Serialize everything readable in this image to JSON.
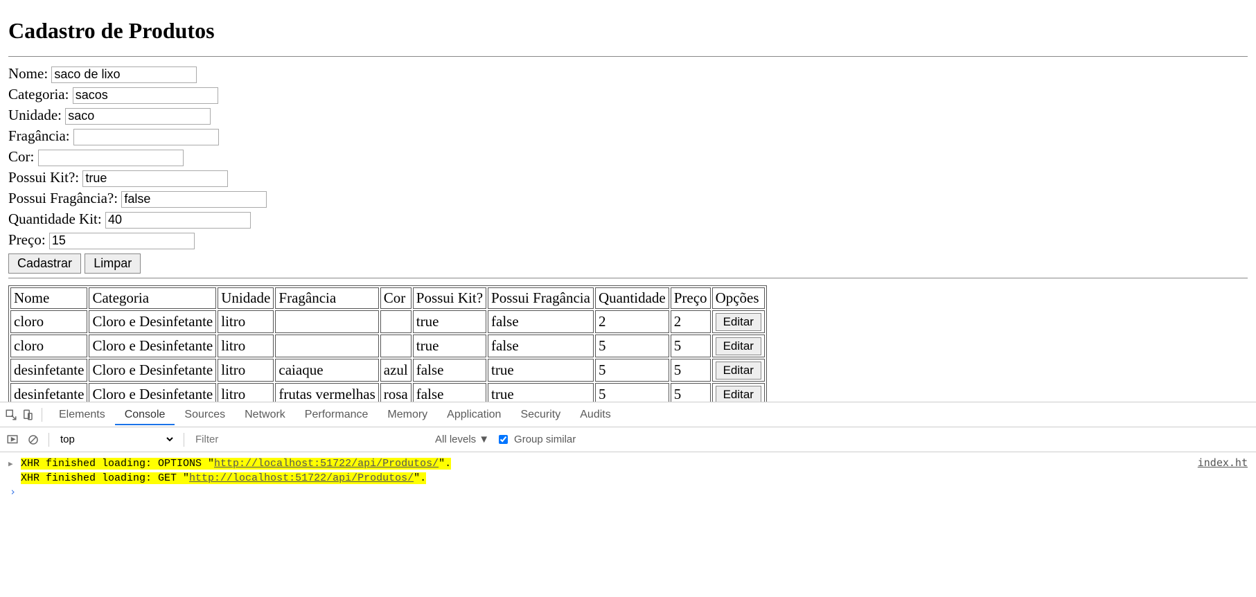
{
  "page": {
    "title": "Cadastro de Produtos"
  },
  "form": {
    "nome": {
      "label": "Nome:",
      "value": "saco de lixo"
    },
    "categoria": {
      "label": "Categoria:",
      "value": "sacos"
    },
    "unidade": {
      "label": "Unidade:",
      "value": "saco"
    },
    "fragancia": {
      "label": "Fragância:",
      "value": ""
    },
    "cor": {
      "label": "Cor:",
      "value": ""
    },
    "possuiKit": {
      "label": "Possui Kit?:",
      "value": "true"
    },
    "possuiFragancia": {
      "label": "Possui Fragância?:",
      "value": "false"
    },
    "quantidadeKit": {
      "label": "Quantidade Kit:",
      "value": "40"
    },
    "preco": {
      "label": "Preço:",
      "value": "15"
    },
    "buttons": {
      "cadastrar": "Cadastrar",
      "limpar": "Limpar"
    }
  },
  "table": {
    "headers": [
      "Nome",
      "Categoria",
      "Unidade",
      "Fragância",
      "Cor",
      "Possui Kit?",
      "Possui Fragância",
      "Quantidade",
      "Preço",
      "Opções"
    ],
    "editLabel": "Editar",
    "rows": [
      {
        "nome": "cloro",
        "categoria": "Cloro e Desinfetante",
        "unidade": "litro",
        "fragancia": "",
        "cor": "",
        "possuiKit": "true",
        "possuiFragancia": "false",
        "quantidade": "2",
        "preco": "2"
      },
      {
        "nome": "cloro",
        "categoria": "Cloro e Desinfetante",
        "unidade": "litro",
        "fragancia": "",
        "cor": "",
        "possuiKit": "true",
        "possuiFragancia": "false",
        "quantidade": "5",
        "preco": "5"
      },
      {
        "nome": "desinfetante",
        "categoria": "Cloro e Desinfetante",
        "unidade": "litro",
        "fragancia": "caiaque",
        "cor": "azul",
        "possuiKit": "false",
        "possuiFragancia": "true",
        "quantidade": "5",
        "preco": "5"
      },
      {
        "nome": "desinfetante",
        "categoria": "Cloro e Desinfetante",
        "unidade": "litro",
        "fragancia": "frutas vermelhas",
        "cor": "rosa",
        "possuiKit": "false",
        "possuiFragancia": "true",
        "quantidade": "5",
        "preco": "5"
      }
    ]
  },
  "devtools": {
    "tabs": [
      "Elements",
      "Console",
      "Sources",
      "Network",
      "Performance",
      "Memory",
      "Application",
      "Security",
      "Audits"
    ],
    "activeTab": "Console",
    "toolbar": {
      "context": "top",
      "filterPlaceholder": "Filter",
      "levels": "All levels",
      "groupSimilar": "Group similar"
    },
    "sourceLink": "index.ht",
    "log": [
      {
        "prefix": "XHR finished loading: ",
        "method": "OPTIONS",
        "q1": " \"",
        "url": "http://localhost:51722/api/Produtos/",
        "q2": "\".",
        "hasTri": true
      },
      {
        "prefix": "XHR finished loading: ",
        "method": "GET",
        "q1": " \"",
        "url": "http://localhost:51722/api/Produtos/",
        "q2": "\".",
        "hasTri": false
      }
    ]
  }
}
